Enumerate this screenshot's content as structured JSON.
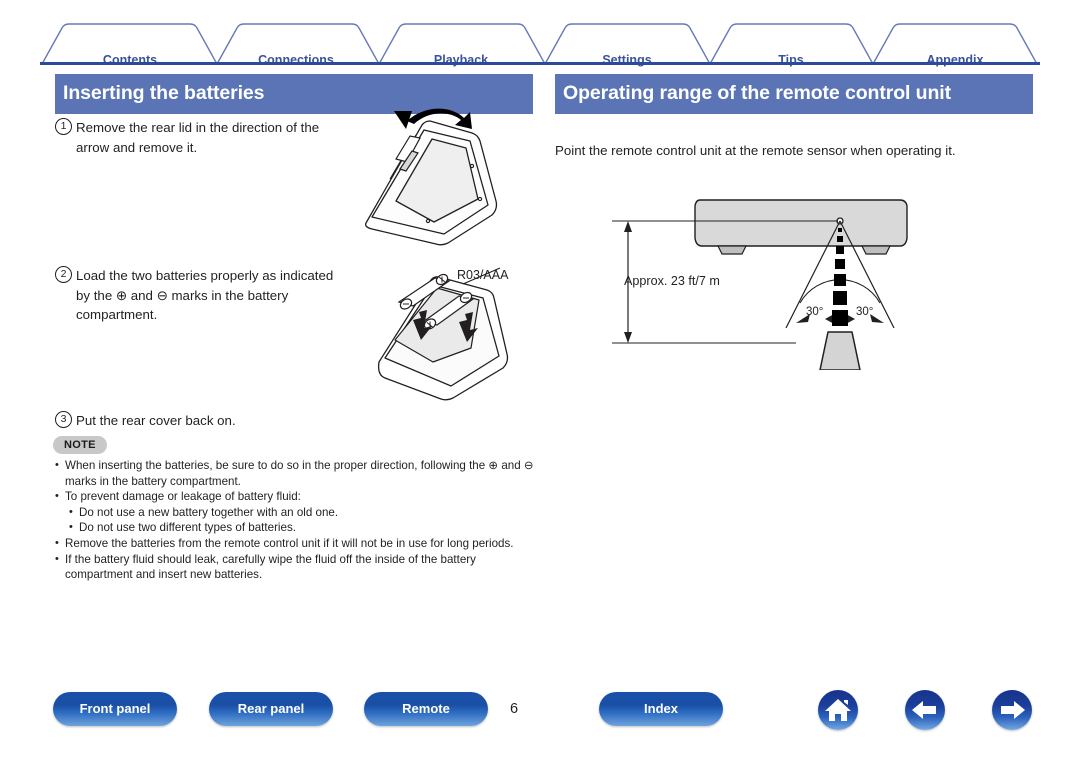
{
  "tabs": [
    {
      "label": "Contents"
    },
    {
      "label": "Connections"
    },
    {
      "label": "Playback"
    },
    {
      "label": "Settings"
    },
    {
      "label": "Tips"
    },
    {
      "label": "Appendix"
    }
  ],
  "left": {
    "header": "Inserting the batteries",
    "steps": [
      {
        "num": "1",
        "text": "Remove the rear lid in the direction of the arrow and remove it."
      },
      {
        "num": "2",
        "text": "Load the two batteries properly as indicated by the ⊕ and ⊖ marks in the battery compartment."
      },
      {
        "num": "3",
        "text": "Put the rear cover back on."
      }
    ],
    "battery_label": "R03/AAA",
    "note": {
      "badge": "NOTE",
      "items": [
        {
          "level": 1,
          "text": "When inserting the batteries, be sure to do so in the proper direction, following the ⊕ and ⊖ marks in the battery compartment."
        },
        {
          "level": 1,
          "text": "To prevent damage or leakage of battery fluid:"
        },
        {
          "level": 2,
          "text": "Do not use a new battery together with an old one."
        },
        {
          "level": 2,
          "text": "Do not use two different types of batteries."
        },
        {
          "level": 1,
          "text": "Remove the batteries from the remote control unit if it will not be in use for long periods."
        },
        {
          "level": 1,
          "text": "If the battery fluid should leak, carefully wipe the fluid off the inside of the battery compartment and insert new batteries."
        }
      ]
    }
  },
  "right": {
    "header": "Operating range of the remote control unit",
    "intro": "Point the remote control unit at the remote sensor when operating it.",
    "distance_label": "Approx. 23 ft/7 m",
    "angle_left": "30°",
    "angle_right": "30°"
  },
  "footer": {
    "buttons": [
      {
        "label": "Front panel"
      },
      {
        "label": "Rear panel"
      },
      {
        "label": "Remote"
      },
      {
        "label": "Index"
      }
    ],
    "page_number": "6",
    "icons": [
      "home-icon",
      "arrow-left-icon",
      "arrow-right-icon"
    ]
  },
  "colors": {
    "tab_text": "#39529b",
    "tab_rule": "#2b4a9b",
    "section_header_bg": "#5b74b5",
    "pill_blue": "#1b50a8",
    "note_badge_bg": "#c8c8c8"
  }
}
